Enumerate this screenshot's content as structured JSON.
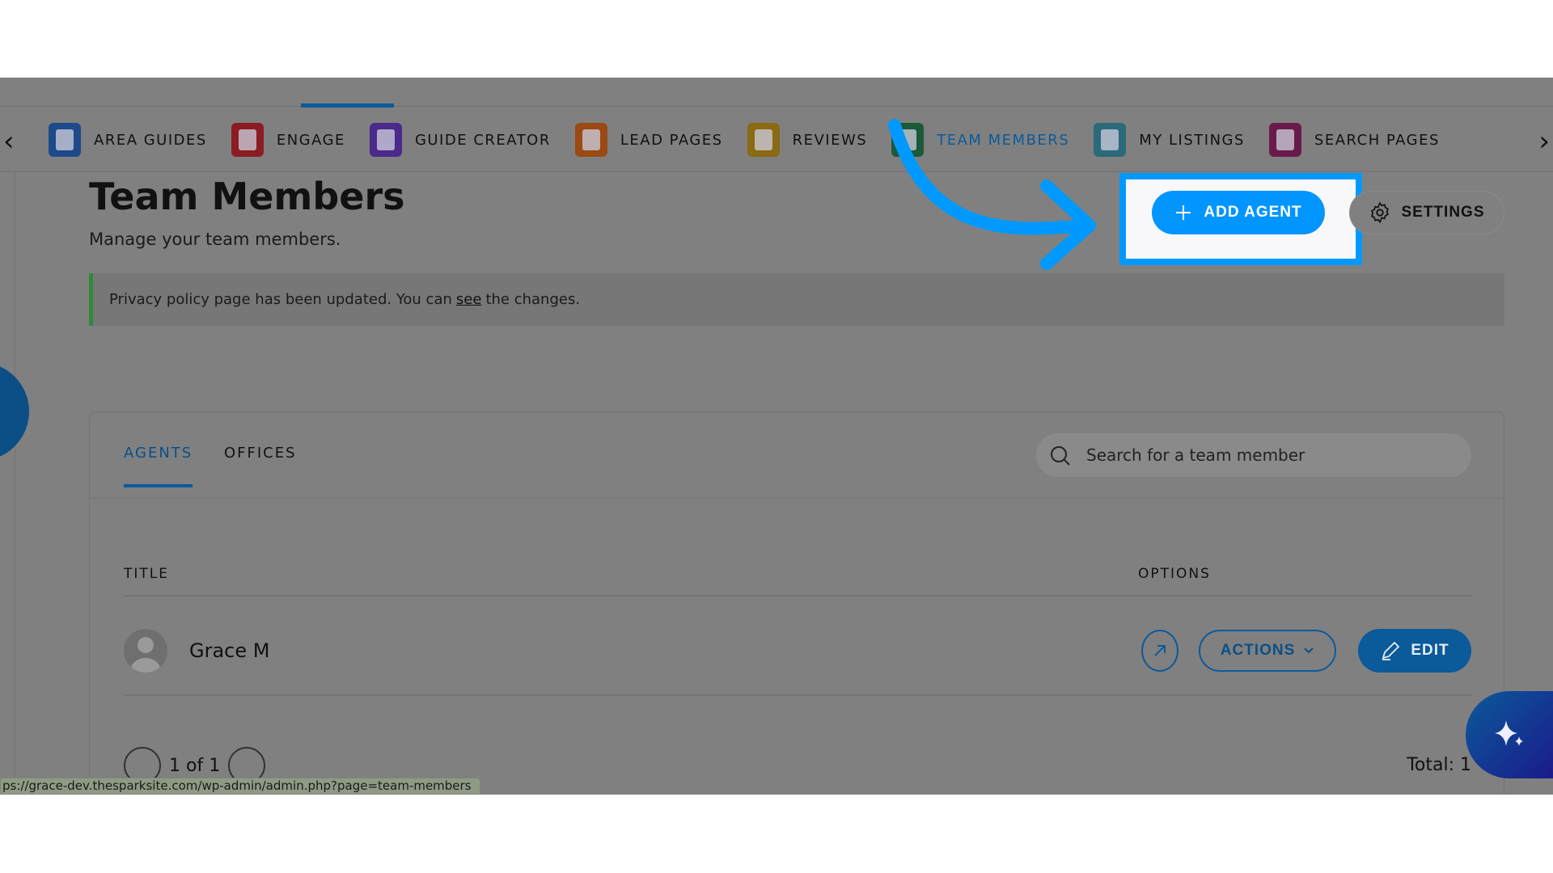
{
  "nav": {
    "items": [
      {
        "label": "AREA GUIDES",
        "icon": "area-guides-icon",
        "color": "#1c4a8a"
      },
      {
        "label": "ENGAGE",
        "icon": "engage-icon",
        "color": "#8a1c22"
      },
      {
        "label": "GUIDE CREATOR",
        "icon": "guide-creator-icon",
        "color": "#4a2a8a"
      },
      {
        "label": "LEAD PAGES",
        "icon": "lead-pages-icon",
        "color": "#9a4a12"
      },
      {
        "label": "REVIEWS",
        "icon": "reviews-icon",
        "color": "#8a6a12"
      },
      {
        "label": "TEAM MEMBERS",
        "icon": "team-members-icon",
        "color": "#1a5a3a",
        "active": true
      },
      {
        "label": "MY LISTINGS",
        "icon": "my-listings-icon",
        "color": "#2a6a7a"
      },
      {
        "label": "SEARCH PAGES",
        "icon": "search-pages-icon",
        "color": "#6a1a4a"
      }
    ]
  },
  "header": {
    "title": "Team Members",
    "subtitle": "Manage your team members.",
    "add_agent": "ADD AGENT",
    "settings": "SETTINGS"
  },
  "notice": {
    "before": "Privacy policy page has been updated. You can",
    "link": "see",
    "after": "the changes."
  },
  "tabs": [
    "AGENTS",
    "OFFICES"
  ],
  "search": {
    "placeholder": "Search for a team member"
  },
  "table": {
    "columns": [
      "TITLE",
      "OPTIONS"
    ],
    "rows": [
      {
        "name": "Grace M",
        "actions": "ACTIONS",
        "edit": "EDIT"
      }
    ]
  },
  "pagination": {
    "text": "1 of 1",
    "total": "Total: 1"
  },
  "status_url": "ps://grace-dev.thesparksite.com/wp-admin/admin.php?page=team-members",
  "colors": {
    "accent": "#0095ff",
    "highlight": "#0099ff",
    "brand": "#0b5a9a"
  }
}
